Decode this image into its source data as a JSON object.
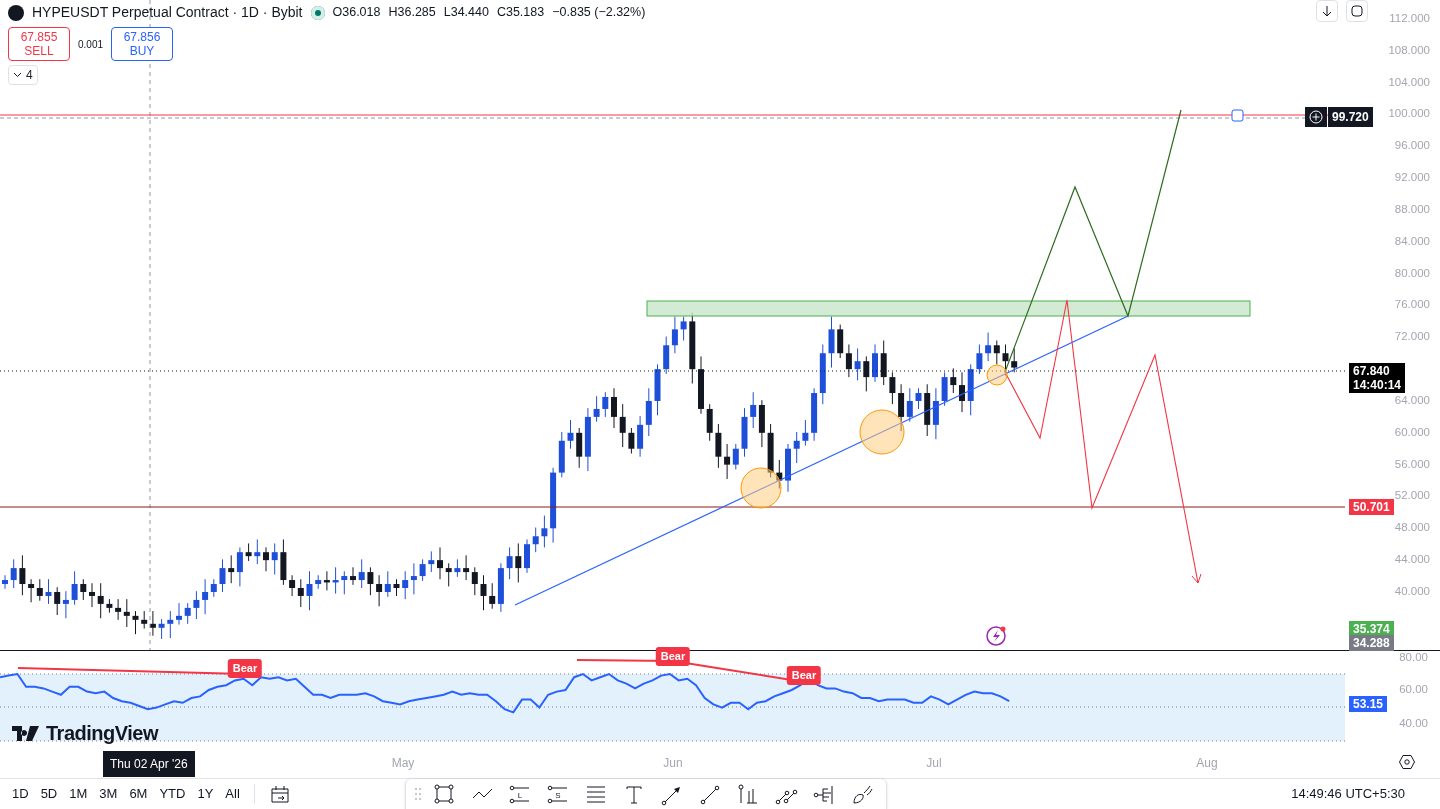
{
  "header": {
    "title": "HYPEUSDT Perpetual Contract · 1D · Bybit",
    "market_open": true,
    "ohlc": [
      "O36.018",
      "H36.285",
      "L34.440",
      "C35.183",
      "−0.835 (−2.32%)"
    ],
    "sell": {
      "price": "67.855",
      "label": "SELL"
    },
    "spread": "0.001",
    "buy": {
      "price": "67.856",
      "label": "BUY"
    },
    "indicators_count": "4"
  },
  "price_axis": {
    "ticks": [
      "112.000",
      "108.000",
      "104.000",
      "100.000",
      "96.000",
      "92.000",
      "88.000",
      "84.000",
      "80.000",
      "76.000",
      "72.000",
      "64.000",
      "60.000",
      "56.000",
      "52.000",
      "48.000",
      "44.000",
      "40.000"
    ],
    "markers": [
      {
        "kind": "add",
        "label": "99.720",
        "color": "#131722"
      },
      {
        "kind": "last",
        "label": "67.840",
        "countdown": "14:40:14",
        "color": "#000000"
      },
      {
        "kind": "line",
        "label": "50.701",
        "color": "#f23645"
      },
      {
        "kind": "line",
        "label": "35.374",
        "color": "#4caf50"
      },
      {
        "kind": "line",
        "label": "34.288",
        "color": "#787b86"
      }
    ]
  },
  "logo": "TradingView",
  "rsi": {
    "ticks": [
      "80.00",
      "60.00",
      "40.00"
    ],
    "value": "53.15",
    "divergences": [
      "Bear",
      "Bear",
      "Bear"
    ]
  },
  "time_axis": {
    "labels": [
      "May",
      "Jun",
      "Jul",
      "Aug"
    ],
    "crosshair": "Thu 02 Apr '26"
  },
  "ranges": [
    "1D",
    "5D",
    "1M",
    "3M",
    "6M",
    "YTD",
    "1Y",
    "All"
  ],
  "tools": [
    {
      "kind": "rect"
    },
    {
      "kind": "zigzag"
    },
    {
      "kind": "letter-lines",
      "letter": "L"
    },
    {
      "kind": "letter-lines",
      "letter": "S"
    },
    {
      "kind": "hlines"
    },
    {
      "kind": "text"
    },
    {
      "kind": "arrow"
    },
    {
      "kind": "line"
    },
    {
      "kind": "pin"
    },
    {
      "kind": "nodes"
    },
    {
      "kind": "tree"
    },
    {
      "kind": "brush"
    }
  ],
  "clock": "14:49:46 UTC+5:30"
}
